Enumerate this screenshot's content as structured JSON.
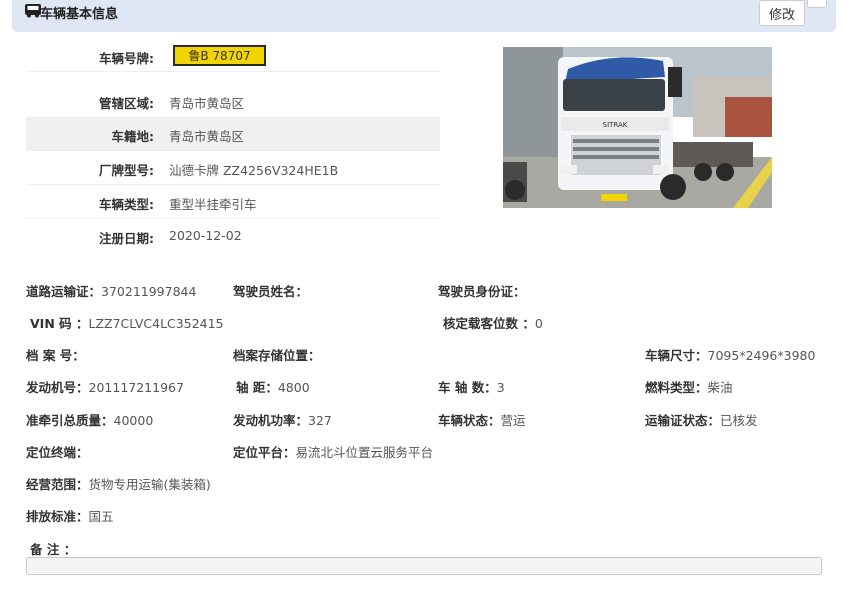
{
  "header": {
    "title": "车辆基本信息",
    "edit_label": "修改"
  },
  "basic": [
    {
      "label": "车辆号牌:",
      "value": ""
    },
    {
      "label": "管辖区域:",
      "value": "青岛市黄岛区"
    },
    {
      "label": "车籍地:",
      "value": "青岛市黄岛区"
    },
    {
      "label": "厂牌型号:",
      "value": "汕德卡牌 ZZ4256V324HE1B"
    },
    {
      "label": "车辆类型:",
      "value": "重型半挂牵引车"
    },
    {
      "label": "注册日期:",
      "value": "2020-12-02"
    }
  ],
  "plate": {
    "text": "鲁B 78707",
    "color": "#f2d400"
  },
  "photo": {
    "brand_text": "SITRAK"
  },
  "fields": {
    "road_permit": {
      "label": "道路运输证：",
      "value": "370211997844"
    },
    "driver_name": {
      "label": "驾驶员姓名：",
      "value": ""
    },
    "driver_id": {
      "label": "驾驶员身份证：",
      "value": ""
    },
    "vin": {
      "label": "VIN 码 ：",
      "value": "LZZ7CLVC4LC352415"
    },
    "seats": {
      "label": "核定载客位数 ：",
      "value": "0"
    },
    "archive_no": {
      "label": "档 案 号：",
      "value": ""
    },
    "archive_loc": {
      "label": "档案存储位置：",
      "value": ""
    },
    "size": {
      "label": "车辆尺寸：",
      "value": "7095*2496*3980"
    },
    "engine_no": {
      "label": "发动机号：",
      "value": "201117211967"
    },
    "wheelbase": {
      "label": "轴 距：",
      "value": "4800"
    },
    "axles": {
      "label": "车 轴 数：",
      "value": "3"
    },
    "fuel": {
      "label": "燃料类型：",
      "value": "柴油"
    },
    "tow_mass": {
      "label": "准牵引总质量：",
      "value": "40000"
    },
    "engine_power": {
      "label": "发动机功率：",
      "value": "327"
    },
    "status": {
      "label": "车辆状态：",
      "value": "营运"
    },
    "permit_status": {
      "label": "运输证状态：",
      "value": "已核发"
    },
    "gps_terminal": {
      "label": "定位终端：",
      "value": ""
    },
    "gps_platform": {
      "label": "定位平台：",
      "value": "易流北斗位置云服务平台"
    },
    "scope": {
      "label": "经营范围：",
      "value": "货物专用运输(集装箱)"
    },
    "emission": {
      "label": "排放标准：",
      "value": "国五"
    },
    "remark": {
      "label": "备 注 ：",
      "value": ""
    }
  }
}
